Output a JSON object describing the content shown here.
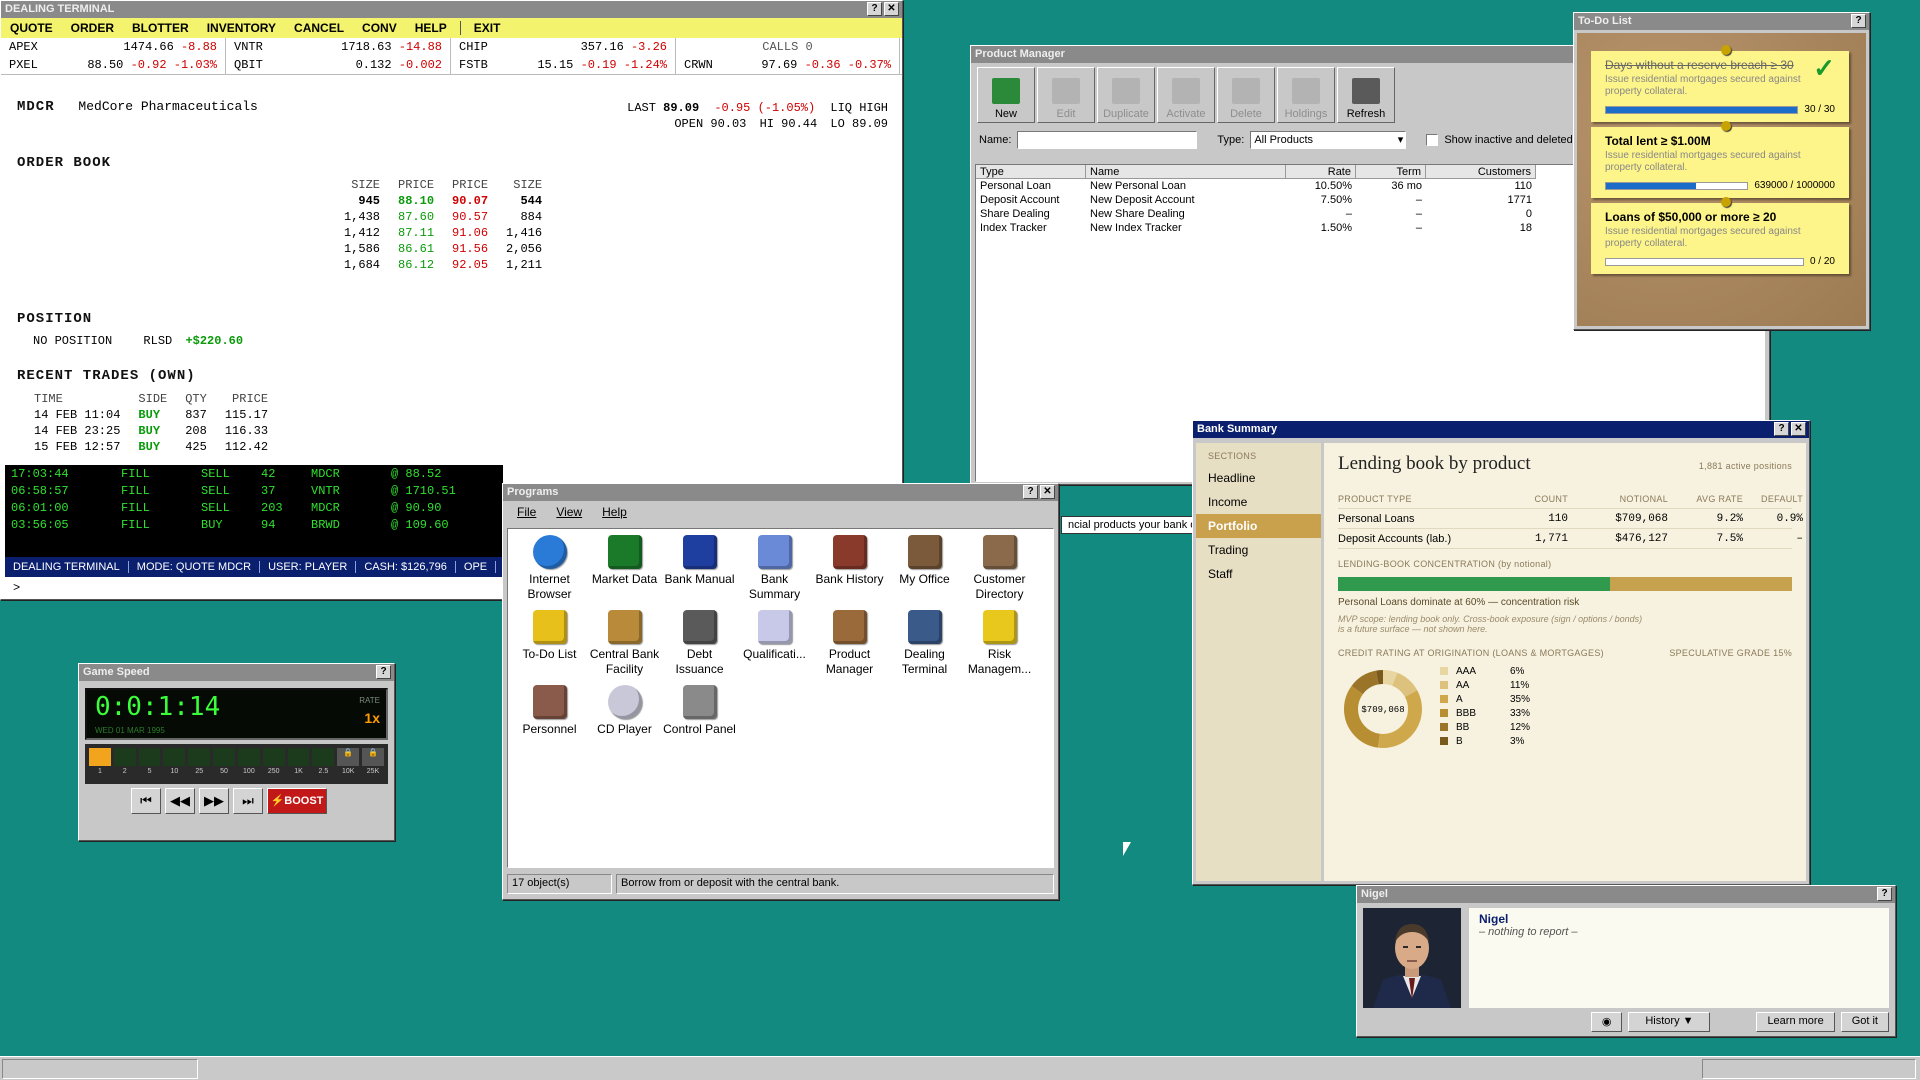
{
  "dealing": {
    "title": "DEALING TERMINAL",
    "menu": [
      "QUOTE",
      "ORDER",
      "BLOTTER",
      "INVENTORY",
      "CANCEL",
      "CONV",
      "HELP",
      "EXIT"
    ],
    "tickers": [
      [
        "APEX",
        "1474.66",
        "-8.88"
      ],
      [
        "VNTR",
        "1718.63",
        "-14.88"
      ],
      [
        "CHIP",
        "357.16",
        "-3.26"
      ],
      [
        "CALLS 0"
      ],
      [
        "PXEL",
        "88.50",
        "-0.92",
        "-1.03%"
      ],
      [
        "QBIT",
        "0.132",
        "-0.002"
      ],
      [
        "FSTB",
        "15.15",
        "-0.19",
        "-1.24%"
      ],
      [
        "CRWN",
        "97.69",
        "-0.36",
        "-0.37%"
      ]
    ],
    "symbol": "MDCR",
    "company": "MedCore Pharmaceuticals",
    "last_label": "LAST",
    "last": "89.09",
    "change": "-0.95",
    "change_pct": "(-1.05%)",
    "liq": "LIQ HIGH",
    "open": "OPEN 90.03",
    "hi": "HI 90.44",
    "lo": "LO 89.09",
    "order_book_title": "ORDER BOOK",
    "ob_headers": [
      "SIZE",
      "PRICE",
      "PRICE",
      "SIZE"
    ],
    "order_book": [
      [
        "945",
        "88.10",
        "90.07",
        "544"
      ],
      [
        "1,438",
        "87.60",
        "90.57",
        "884"
      ],
      [
        "1,412",
        "87.11",
        "91.06",
        "1,416"
      ],
      [
        "1,586",
        "86.61",
        "91.56",
        "2,056"
      ],
      [
        "1,684",
        "86.12",
        "92.05",
        "1,211"
      ]
    ],
    "position_title": "POSITION",
    "position_text": "NO POSITION",
    "rlsd_label": "RLSD",
    "rlsd_value": "+$220.60",
    "recent_title": "RECENT TRADES (OWN)",
    "trade_headers": [
      "TIME",
      "SIDE",
      "QTY",
      "PRICE"
    ],
    "trades": [
      [
        "14 FEB 11:04",
        "BUY",
        "837",
        "115.17"
      ],
      [
        "14 FEB 23:25",
        "BUY",
        "208",
        "116.33"
      ],
      [
        "15 FEB 12:57",
        "BUY",
        "425",
        "112.42"
      ]
    ],
    "fills": [
      [
        "17:03:44",
        "FILL",
        "SELL",
        "42",
        "MDCR",
        "@ 88.52"
      ],
      [
        "06:58:57",
        "FILL",
        "SELL",
        "37",
        "VNTR",
        "@ 1710.51"
      ],
      [
        "06:01:00",
        "FILL",
        "SELL",
        "203",
        "MDCR",
        "@ 90.90"
      ],
      [
        "03:56:05",
        "FILL",
        "BUY",
        "94",
        "BRWD",
        "@ 109.60"
      ]
    ],
    "status": [
      "DEALING TERMINAL",
      "MODE: QUOTE MDCR",
      "USER: PLAYER",
      "CASH: $126,796",
      "OPE"
    ],
    "prompt": ">"
  },
  "product_manager": {
    "title": "Product Manager",
    "toolbar": [
      "New",
      "Edit",
      "Duplicate",
      "Activate",
      "Delete",
      "Holdings",
      "Refresh"
    ],
    "name_label": "Name:",
    "type_label": "Type:",
    "type_value": "All Products",
    "inactive_label": "Show inactive and deleted",
    "columns": [
      "Type",
      "Name",
      "Rate",
      "Term",
      "Customers"
    ],
    "rows": [
      [
        "Personal Loan",
        "New Personal Loan",
        "10.50%",
        "36 mo",
        "110"
      ],
      [
        "Deposit Account",
        "New Deposit Account",
        "7.50%",
        "–",
        "1771"
      ],
      [
        "Share Dealing",
        "New Share Dealing",
        "–",
        "–",
        "0"
      ],
      [
        "Index Tracker",
        "New Index Tracker",
        "1.50%",
        "–",
        "18"
      ]
    ],
    "tooltip": "ncial products your bank off"
  },
  "todo": {
    "title": "To-Do List",
    "items": [
      {
        "title": "Days without a reserve breach ≥ 30",
        "desc": "Issue residential mortgages secured against property collateral.",
        "progress": "30 / 30",
        "fraction": 1.0,
        "done": true
      },
      {
        "title": "Total lent ≥ $1.00M",
        "desc": "Issue residential mortgages secured against property collateral.",
        "progress": "639000 / 1000000",
        "fraction": 0.639,
        "done": false
      },
      {
        "title": "Loans of $50,000 or more ≥ 20",
        "desc": "Issue residential mortgages secured against property collateral.",
        "progress": "0 / 20",
        "fraction": 0,
        "done": false
      }
    ]
  },
  "bank_summary": {
    "title": "Bank Summary",
    "sections_label": "SECTIONS",
    "sections": [
      "Headline",
      "Income",
      "Portfolio",
      "Trading",
      "Staff"
    ],
    "active_section": "Portfolio",
    "heading": "Lending book by product",
    "active_positions": "1,881 active positions",
    "columns": [
      "PRODUCT TYPE",
      "COUNT",
      "NOTIONAL",
      "AVG RATE",
      "DEFAULT"
    ],
    "rows": [
      [
        "Personal Loans",
        "110",
        "$709,068",
        "9.2%",
        "0.9%"
      ],
      [
        "Deposit Accounts (lab.)",
        "1,771",
        "$476,127",
        "7.5%",
        "–"
      ]
    ],
    "concentration_label": "LENDING-BOOK CONCENTRATION (by notional)",
    "concentration_fraction": 0.6,
    "concentration_note": "Personal Loans dominate at 60% — concentration risk",
    "scope_note_1": "MVP scope: lending book only. Cross-book exposure (sign / options / bonds)",
    "scope_note_2": "is a future surface — not shown here.",
    "credit_label": "CREDIT RATING AT ORIGINATION (LOANS & MORTGAGES)",
    "spec_label": "SPECULATIVE GRADE 15%",
    "donut_center": "$709,068",
    "ratings": [
      {
        "label": "AAA",
        "pct": 6,
        "color": "#e8d6a2"
      },
      {
        "label": "AA",
        "pct": 11,
        "color": "#dcc27c"
      },
      {
        "label": "A",
        "pct": 35,
        "color": "#cfa84c"
      },
      {
        "label": "BBB",
        "pct": 33,
        "color": "#b78e32"
      },
      {
        "label": "BB",
        "pct": 12,
        "color": "#9a7428"
      },
      {
        "label": "B",
        "pct": 3,
        "color": "#7a5a1c"
      }
    ]
  },
  "programs": {
    "title": "Programs",
    "menu": [
      "File",
      "View",
      "Help"
    ],
    "icons": [
      {
        "label": "Internet Browser",
        "icon": "globe-icon",
        "color": "#2a7bd8"
      },
      {
        "label": "Market Data",
        "icon": "chart-icon",
        "color": "#1a7a2a"
      },
      {
        "label": "Bank Manual",
        "icon": "book-icon",
        "color": "#1e3fa0"
      },
      {
        "label": "Bank Summary",
        "icon": "report-icon",
        "color": "#6a8ad8"
      },
      {
        "label": "Bank History",
        "icon": "history-icon",
        "color": "#8a3a2a"
      },
      {
        "label": "My Office",
        "icon": "office-icon",
        "color": "#7a5a3a"
      },
      {
        "label": "Customer Directory",
        "icon": "directory-icon",
        "color": "#8a6a4a"
      },
      {
        "label": "To-Do List",
        "icon": "notepad-icon",
        "color": "#e8c01c"
      },
      {
        "label": "Central Bank Facility",
        "icon": "bank-icon",
        "color": "#b88a3a"
      },
      {
        "label": "Debt Issuance",
        "icon": "pen-icon",
        "color": "#5a5a5a"
      },
      {
        "label": "Qualificati...",
        "icon": "certificate-icon",
        "color": "#c8c8e8"
      },
      {
        "label": "Product Manager",
        "icon": "boxes-icon",
        "color": "#9a6a3a"
      },
      {
        "label": "Dealing Terminal",
        "icon": "terminal-icon",
        "color": "#3a5a8a"
      },
      {
        "label": "Risk Managem...",
        "icon": "shield-icon",
        "color": "#e8c81c"
      },
      {
        "label": "Personnel",
        "icon": "people-icon",
        "color": "#8a5a4a"
      },
      {
        "label": "CD Player",
        "icon": "cd-icon",
        "color": "#c8c8d8"
      },
      {
        "label": "Control Panel",
        "icon": "gear-icon",
        "color": "#8a8a8a"
      }
    ],
    "status_count": "17 object(s)",
    "status_text": "Borrow from or deposit with the central bank."
  },
  "game_speed": {
    "title": "Game Speed",
    "time": "0:0:1:14",
    "date": "WED 01 MAR 1995",
    "rate_label": "RATE",
    "rate": "1x",
    "speeds": [
      "1",
      "2",
      "5",
      "10",
      "25",
      "50",
      "100",
      "250",
      "1K",
      "2.5",
      "10K",
      "25K"
    ],
    "active_speed_index": 0,
    "boost": "⚡BOOST"
  },
  "nigel": {
    "title": "Nigel",
    "name": "Nigel",
    "message": "– nothing to report –",
    "history": "History ▼",
    "learn_more": "Learn more",
    "got_it": "Got it"
  }
}
